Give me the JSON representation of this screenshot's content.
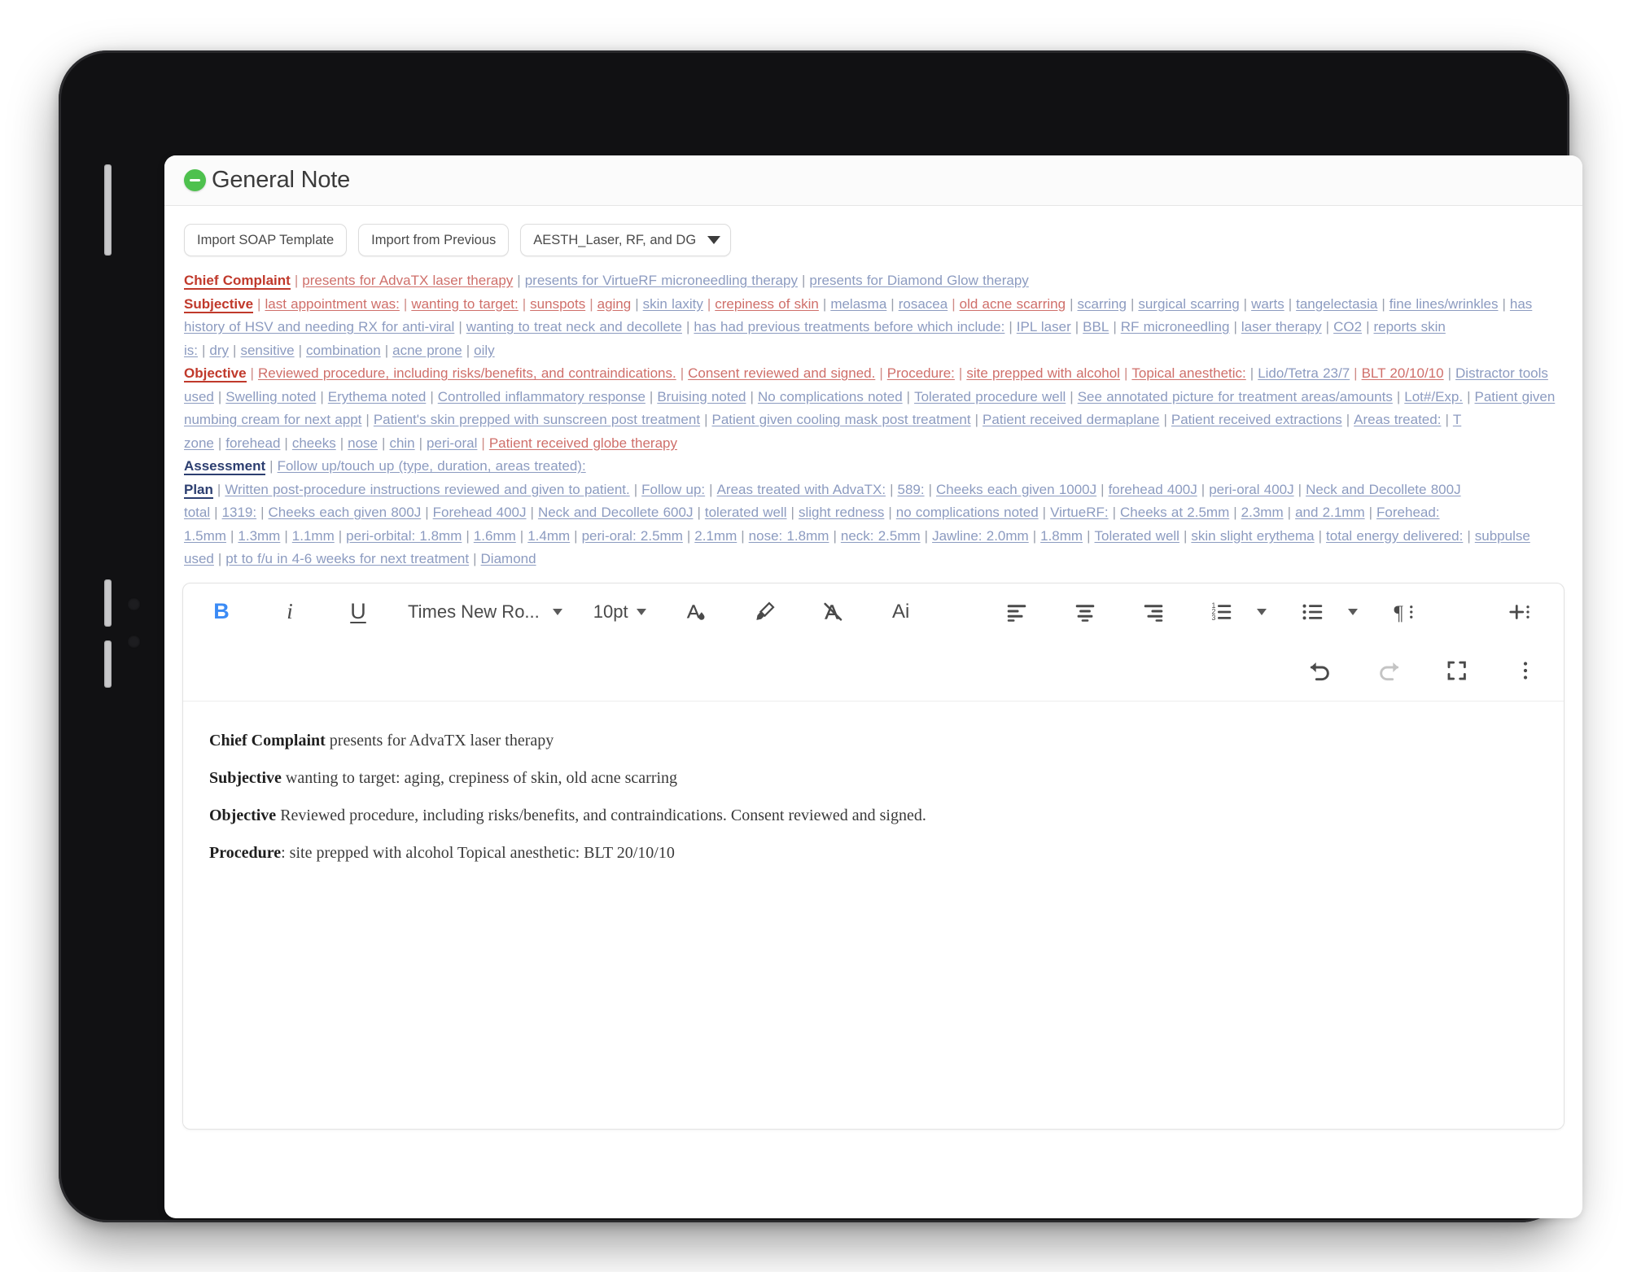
{
  "window": {
    "title": "General Note",
    "collapse_icon": "collapse-circle-icon",
    "accent_green": "#4ec14e"
  },
  "toolbar_top": {
    "import_soap_label": "Import SOAP Template",
    "import_previous_label": "Import from Previous",
    "template_select_value": "AESTH_Laser, RF, and DG",
    "caret_icon": "chevron-down-icon"
  },
  "template": {
    "sections": [
      {
        "heading": "Chief Complaint",
        "heading_color": "red",
        "links": [
          {
            "text": "presents for AdvaTX laser therapy",
            "color": "red"
          },
          {
            "text": "presents for VirtueRF microneedling therapy",
            "color": "blue"
          },
          {
            "text": "presents for Diamond Glow therapy",
            "color": "blue"
          }
        ]
      },
      {
        "heading": "Subjective",
        "heading_color": "red",
        "links": [
          {
            "text": "last appointment was:",
            "color": "red"
          },
          {
            "text": "wanting to target:",
            "color": "red"
          },
          {
            "text": "sunspots",
            "color": "red"
          },
          {
            "text": "aging",
            "color": "red"
          },
          {
            "text": "skin laxity",
            "color": "blue"
          },
          {
            "text": "crepiness of skin",
            "color": "red"
          },
          {
            "text": "melasma",
            "color": "blue"
          },
          {
            "text": "rosacea",
            "color": "blue"
          },
          {
            "text": "old acne scarring",
            "color": "red"
          },
          {
            "text": "scarring",
            "color": "blue"
          },
          {
            "text": "surgical scarring",
            "color": "blue"
          },
          {
            "text": "warts",
            "color": "blue"
          },
          {
            "text": "tangelectasia",
            "color": "blue"
          },
          {
            "text": "fine lines/wrinkles",
            "color": "blue"
          },
          {
            "text": "has history of HSV and needing RX for anti-viral",
            "color": "blue"
          },
          {
            "text": "wanting to treat neck and decollete",
            "color": "blue"
          },
          {
            "text": "has had previous treatments before which include:",
            "color": "blue"
          },
          {
            "text": "IPL laser",
            "color": "blue"
          },
          {
            "text": "BBL",
            "color": "blue"
          },
          {
            "text": "RF microneedling",
            "color": "blue"
          },
          {
            "text": "laser therapy",
            "color": "blue"
          },
          {
            "text": "CO2",
            "color": "blue"
          },
          {
            "text": "reports skin is:",
            "color": "blue"
          },
          {
            "text": "dry",
            "color": "blue"
          },
          {
            "text": "sensitive",
            "color": "blue"
          },
          {
            "text": "combination",
            "color": "blue"
          },
          {
            "text": "acne prone",
            "color": "blue"
          },
          {
            "text": "oily",
            "color": "blue"
          }
        ]
      },
      {
        "heading": "Objective",
        "heading_color": "red",
        "links": [
          {
            "text": "Reviewed procedure, including risks/benefits, and contraindications.",
            "color": "red"
          },
          {
            "text": "Consent reviewed and signed.",
            "color": "red"
          },
          {
            "text": "Procedure:",
            "color": "red"
          },
          {
            "text": "site prepped with alcohol",
            "color": "red"
          },
          {
            "text": "Topical anesthetic:",
            "color": "red"
          },
          {
            "text": "Lido/Tetra 23/7",
            "color": "blue"
          },
          {
            "text": "BLT 20/10/10",
            "color": "red"
          },
          {
            "text": "Distractor tools used",
            "color": "blue"
          },
          {
            "text": "Swelling noted",
            "color": "blue"
          },
          {
            "text": "Erythema noted",
            "color": "blue"
          },
          {
            "text": "Controlled inflammatory response",
            "color": "blue"
          },
          {
            "text": "Bruising noted",
            "color": "blue"
          },
          {
            "text": "No complications noted",
            "color": "blue"
          },
          {
            "text": "Tolerated procedure well",
            "color": "blue"
          },
          {
            "text": "See annotated picture for treatment areas/amounts",
            "color": "blue"
          },
          {
            "text": "Lot#/Exp.",
            "color": "blue"
          },
          {
            "text": "Patient given numbing cream for next appt",
            "color": "blue"
          },
          {
            "text": "Patient's skin prepped with sunscreen post treatment",
            "color": "blue"
          },
          {
            "text": "Patient given cooling mask post treatment",
            "color": "blue"
          },
          {
            "text": "Patient received dermaplane",
            "color": "blue"
          },
          {
            "text": "Patient received extractions",
            "color": "blue"
          },
          {
            "text": "Areas treated:",
            "color": "blue"
          },
          {
            "text": "T zone",
            "color": "blue"
          },
          {
            "text": "forehead",
            "color": "blue"
          },
          {
            "text": "cheeks",
            "color": "blue"
          },
          {
            "text": "nose",
            "color": "blue"
          },
          {
            "text": "chin",
            "color": "blue"
          },
          {
            "text": "peri-oral",
            "color": "blue"
          },
          {
            "text": "Patient received globe therapy",
            "color": "red"
          }
        ]
      },
      {
        "heading": "Assessment",
        "heading_color": "blue",
        "links": [
          {
            "text": "Follow up/touch up (type, duration, areas treated):",
            "color": "blue"
          }
        ]
      },
      {
        "heading": "Plan",
        "heading_color": "blue",
        "links": [
          {
            "text": "Written post-procedure instructions reviewed and given to patient.",
            "color": "blue"
          },
          {
            "text": "Follow up:",
            "color": "blue"
          },
          {
            "text": "Areas treated with AdvaTX:",
            "color": "blue"
          },
          {
            "text": "589:",
            "color": "blue"
          },
          {
            "text": "Cheeks each given 1000J",
            "color": "blue"
          },
          {
            "text": "forehead 400J",
            "color": "blue"
          },
          {
            "text": "peri-oral 400J",
            "color": "blue"
          },
          {
            "text": "Neck and Decollete 800J total",
            "color": "blue"
          },
          {
            "text": "1319:",
            "color": "blue"
          },
          {
            "text": "Cheeks each given 800J",
            "color": "blue"
          },
          {
            "text": "Forehead 400J",
            "color": "blue"
          },
          {
            "text": "Neck and Decollete 600J",
            "color": "blue"
          },
          {
            "text": "tolerated well",
            "color": "blue"
          },
          {
            "text": "slight redness",
            "color": "blue"
          },
          {
            "text": "no complications noted",
            "color": "blue"
          },
          {
            "text": "VirtueRF:",
            "color": "blue"
          },
          {
            "text": "Cheeks at 2.5mm",
            "color": "blue"
          },
          {
            "text": "2.3mm",
            "color": "blue"
          },
          {
            "text": "and 2.1mm",
            "color": "blue"
          },
          {
            "text": "Forehead: 1.5mm",
            "color": "blue"
          },
          {
            "text": "1.3mm",
            "color": "blue"
          },
          {
            "text": "1.1mm",
            "color": "blue"
          },
          {
            "text": "peri-orbital: 1.8mm",
            "color": "blue"
          },
          {
            "text": "1.6mm",
            "color": "blue"
          },
          {
            "text": "1.4mm",
            "color": "blue"
          },
          {
            "text": "peri-oral: 2.5mm",
            "color": "blue"
          },
          {
            "text": "2.1mm",
            "color": "blue"
          },
          {
            "text": "nose: 1.8mm",
            "color": "blue"
          },
          {
            "text": "neck: 2.5mm",
            "color": "blue"
          },
          {
            "text": "Jawline: 2.0mm",
            "color": "blue"
          },
          {
            "text": "1.8mm",
            "color": "blue"
          },
          {
            "text": "Tolerated well",
            "color": "blue"
          },
          {
            "text": "skin slight erythema",
            "color": "blue"
          },
          {
            "text": "total energy delivered:",
            "color": "blue"
          },
          {
            "text": "subpulse used",
            "color": "blue"
          },
          {
            "text": "pt to f/u in 4-6 weeks for next treatment",
            "color": "blue"
          },
          {
            "text": "Diamond",
            "color": "blue"
          }
        ]
      }
    ]
  },
  "editor": {
    "bold_label": "B",
    "italic_label": "i",
    "underline_label": "U",
    "font_family_value": "Times New Ro...",
    "font_size_value": "10pt",
    "ai_label": "Ai",
    "icons": {
      "bold": "bold-icon",
      "italic": "italic-icon",
      "underline": "underline-icon",
      "font_caret": "chevron-down-icon",
      "size_caret": "chevron-down-icon",
      "text_color": "text-color-icon",
      "highlight": "highlighter-icon",
      "clear_format": "clear-formatting-icon",
      "ai_assist": "ai-assist-icon",
      "align_left": "align-left-icon",
      "align_center": "align-center-icon",
      "align_right": "align-right-icon",
      "ordered_list": "numbered-list-icon",
      "ordered_caret": "chevron-down-icon",
      "bullet_list": "bullet-list-icon",
      "bullet_caret": "chevron-down-icon",
      "paragraph": "paragraph-mark-icon",
      "insert": "insert-plus-icon",
      "undo": "undo-icon",
      "redo": "redo-icon",
      "fullscreen": "fullscreen-icon",
      "more": "more-vertical-icon"
    }
  },
  "document": {
    "paragraphs": [
      {
        "label": "Chief Complaint",
        "text": " presents for AdvaTX laser therapy"
      },
      {
        "label": "Subjective",
        "text": " wanting to target: aging, crepiness of skin, old acne scarring"
      },
      {
        "label": "Objective",
        "text": " Reviewed procedure, including risks/benefits, and contraindications. Consent reviewed and signed."
      },
      {
        "label": "Procedure",
        "text": ": site prepped with alcohol Topical anesthetic: BLT 20/10/10"
      }
    ]
  }
}
